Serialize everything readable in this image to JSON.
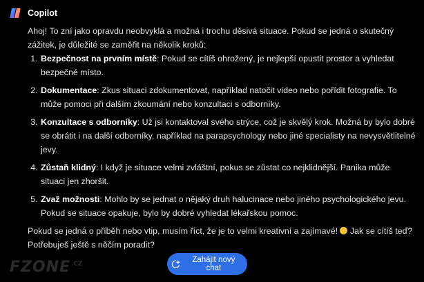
{
  "app": {
    "title": "Copilot"
  },
  "message": {
    "intro": "Ahoj! To zní jako opravdu neobvyklá a možná i trochu děsivá situace. Pokud se jedná o skutečný zážitek, je důležité se zaměřit na několik kroků:",
    "steps": [
      {
        "title": "Bezpečnost na prvním místě",
        "text": ": Pokud se cítíš ohrožený, je nejlepší opustit prostor a vyhledat bezpečné místo."
      },
      {
        "title": "Dokumentace",
        "text": ": Zkus situaci zdokumentovat, například natočit video nebo pořídit fotografie. To může pomoci při dalším zkoumání nebo konzultaci s odborníky."
      },
      {
        "title": "Konzultace s odborníky",
        "text": ": Už jsi kontaktoval svého strýce, což je skvělý krok. Možná by bylo dobré se obrátit i na další odborníky, například na parapsychology nebo jiné specialisty na nevysvětlitelné jevy."
      },
      {
        "title": "Zůstaň klidný",
        "text": ": I když je situace velmi zvláštní, pokus se zůstat co nejklidnější. Panika může situaci jen zhoršit."
      },
      {
        "title": "Zvaž možnosti",
        "text": ": Mohlo by se jednat o nějaký druh halucinace nebo jiného psychologického jevu. Pokud se situace opakuje, bylo by dobré vyhledat lékařskou pomoc."
      }
    ],
    "outro_before_emoji": "Pokud se jedná o příběh nebo vtip, musím říct, že je to velmi kreativní a zajímavé! ",
    "emoji_icon": "smiling-face-emoji",
    "outro_after_emoji": " Jak se cítíš teď? Potřebuješ ještě s něčím poradit?"
  },
  "new_chat_button": {
    "label": "Zahájit nový chat",
    "icon": "new-chat-icon",
    "color": "#2f6fe6"
  },
  "watermark": {
    "text": "FZONE",
    "sub": ".CZ"
  }
}
